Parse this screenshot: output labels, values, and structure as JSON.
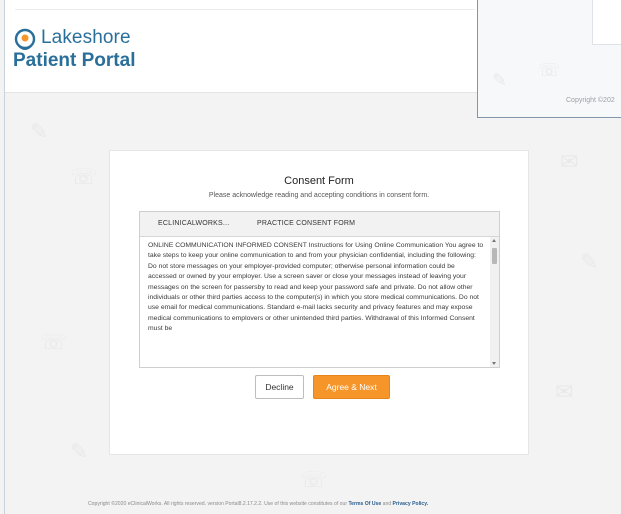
{
  "brand": {
    "line1": "Lakeshore",
    "line2": "Patient Portal",
    "color": "#2a6f9a"
  },
  "popup": {
    "copyright": "Copyright ©202"
  },
  "consent": {
    "title": "Consent Form",
    "subtitle": "Please acknowledge reading and accepting conditions in consent form.",
    "tabs": [
      {
        "label": "ECLINICALWORKS..."
      },
      {
        "label": "PRACTICE CONSENT FORM"
      }
    ],
    "body": "ONLINE COMMUNICATION INFORMED CONSENT Instructions for Using Online Communication You agree to take steps to keep your online communication to and from your physician confidential, including the following: Do not store messages on your employer-provided computer; otherwise personal information could be accessed or owned by your employer. Use a screen saver or close your messages instead of leaving your messages on the screen for passersby to read and keep your password safe and private. Do not allow other individuals or other third parties access to the computer(s) in which you store medical communications. Do not use email for medical communications. Standard e-mail lacks security and privacy features and may expose medical communications to emplovers or other unintended third parties. Withdrawal of this Informed Consent must be"
  },
  "buttons": {
    "decline": "Decline",
    "agree": "Agree & Next",
    "accent_color": "#f5952a"
  },
  "footer": {
    "text": "Copyright ©2020 eClinicalWorks. All rights reserved. version Portal8.2.17.2.2.  Use of this website constitutes of our ",
    "terms_link": "Terms Of Use",
    "and_text": " and ",
    "privacy_link": "Privacy Policy."
  }
}
